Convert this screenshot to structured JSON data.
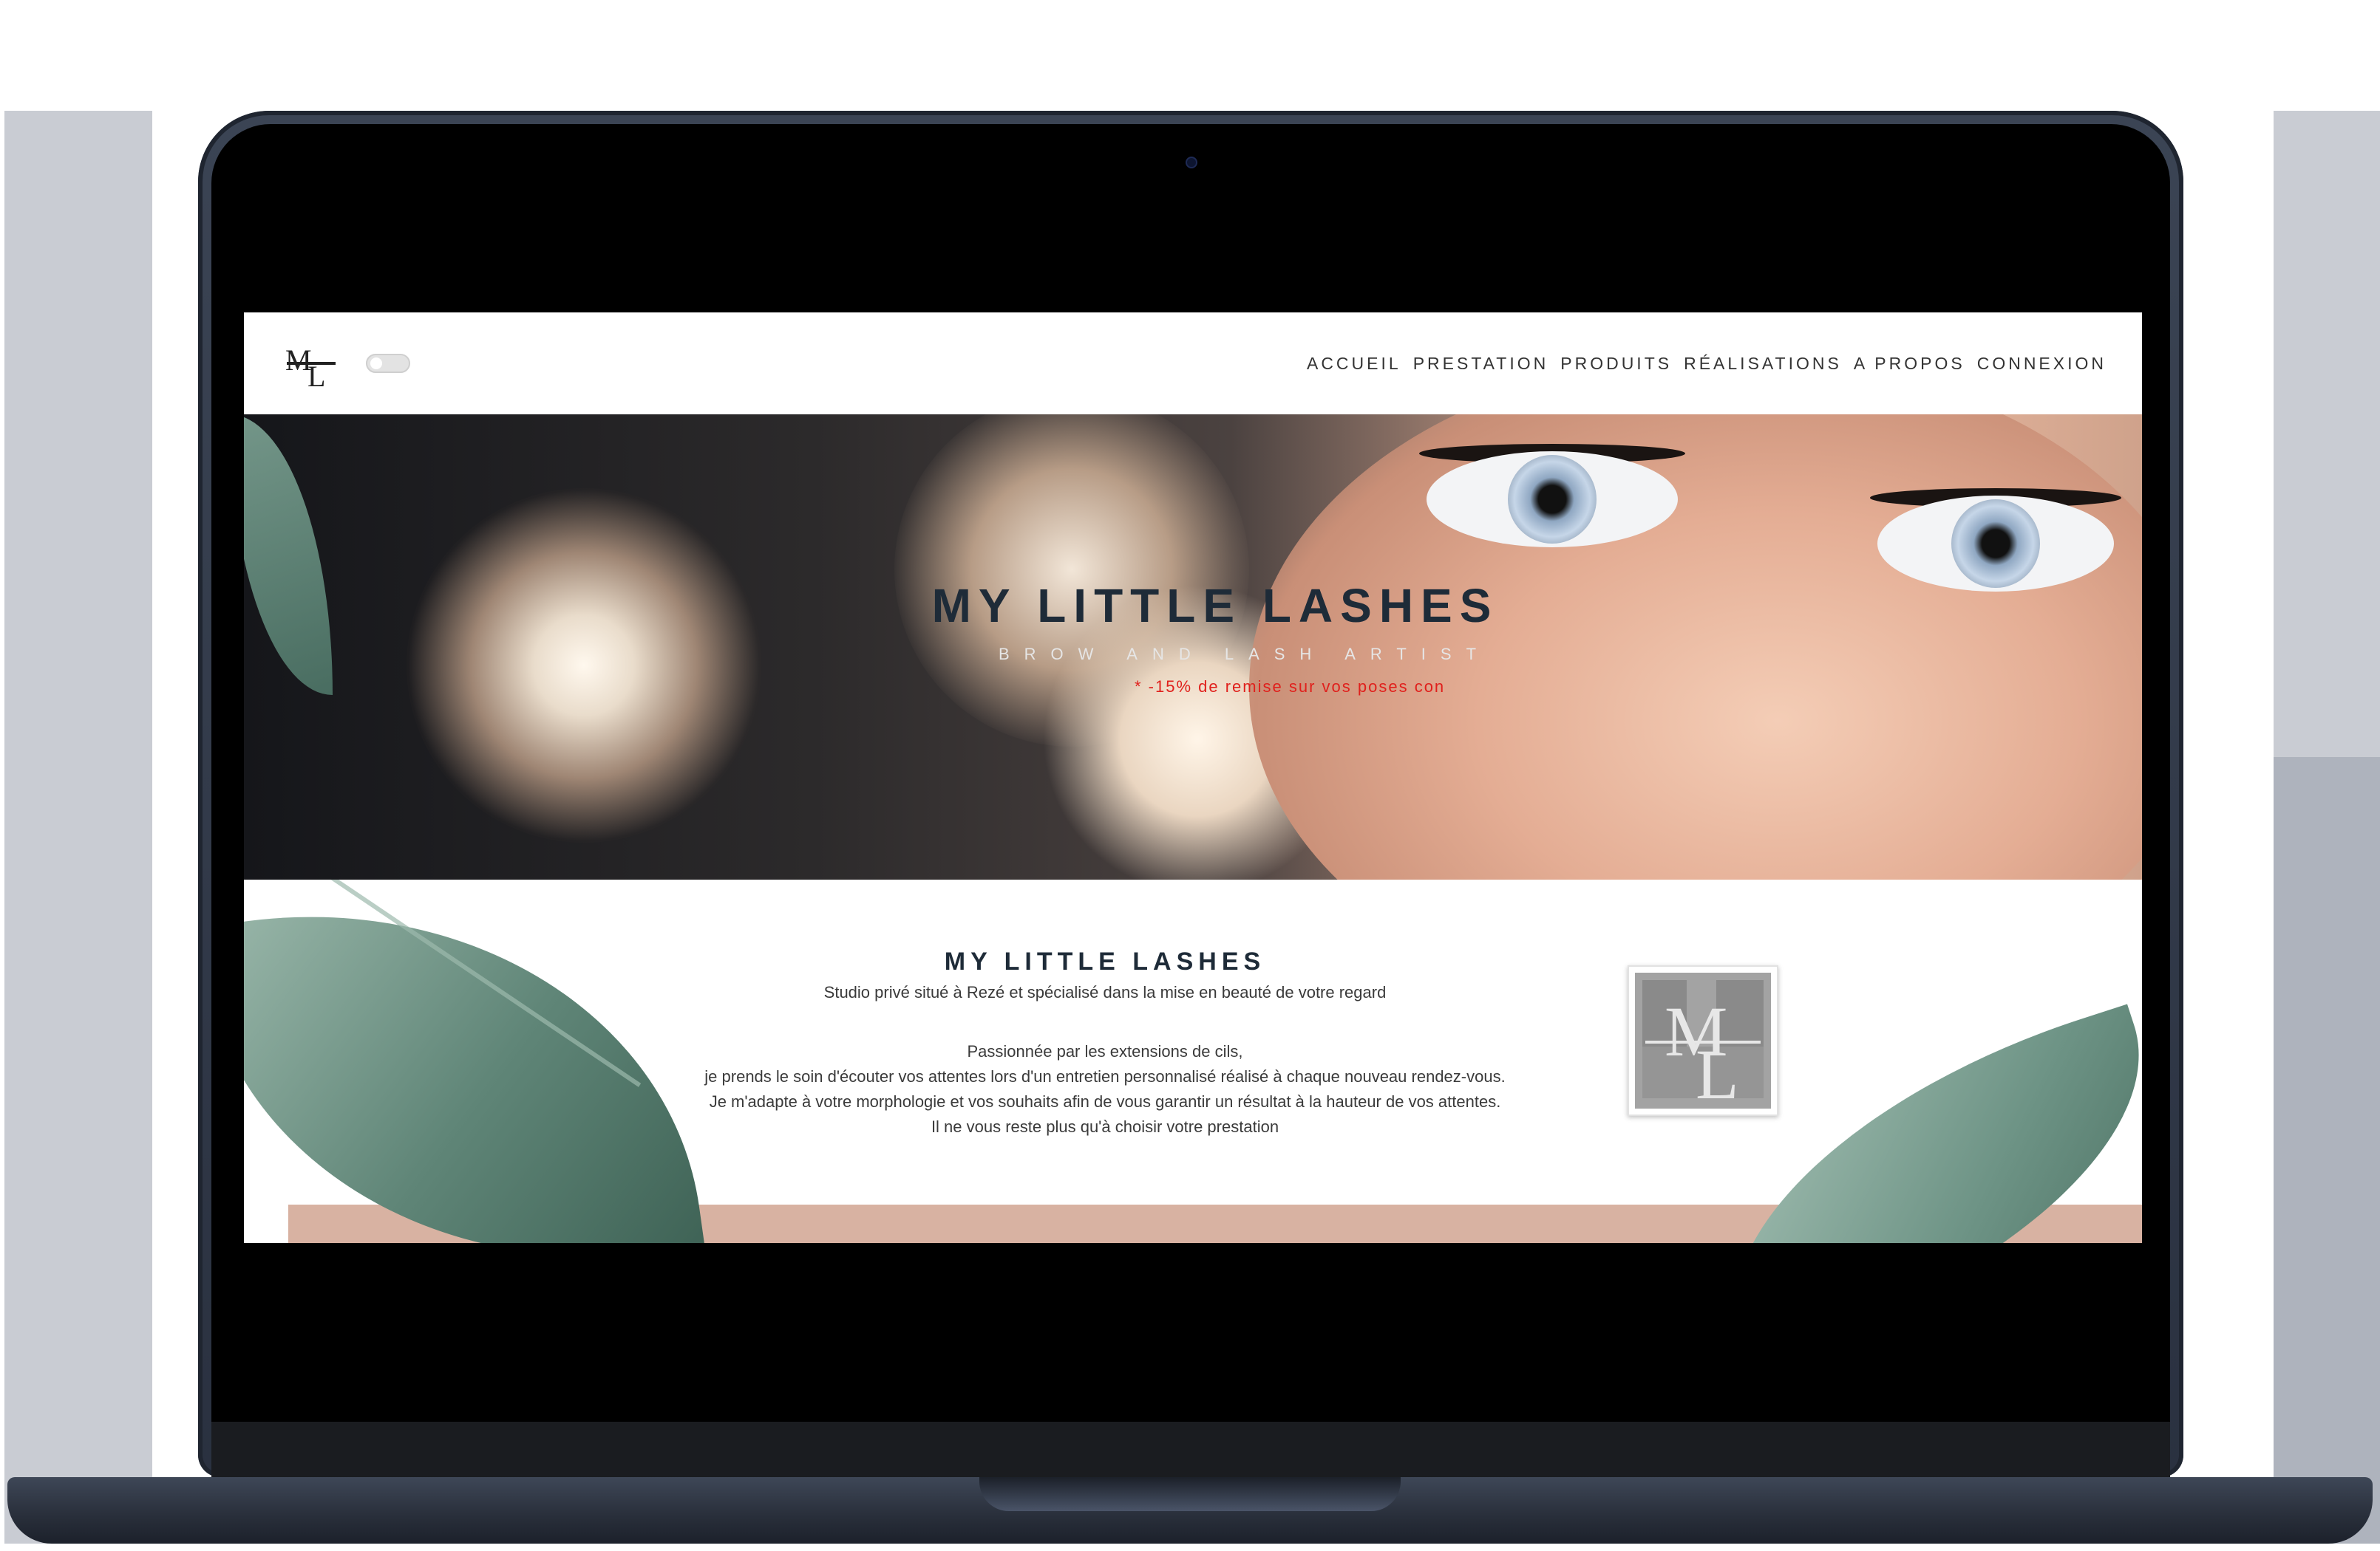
{
  "header": {
    "nav": [
      "ACCUEIL",
      "PRESTATION",
      "PRODUITS",
      "RÉALISATIONS",
      "A PROPOS",
      "CONNEXION"
    ]
  },
  "hero": {
    "title": "MY LITTLE LASHES",
    "subtitle": "BROW AND LASH ARTIST",
    "promo": "* -15% de remise sur vos poses con"
  },
  "intro": {
    "title": "MY LITTLE LASHES",
    "lead": "Studio privé situé à Rezé et spécialisé dans la mise en beauté de votre regard",
    "paragraph": [
      "Passionnée par les extensions de cils,",
      "je prends le soin d'écouter vos attentes lors d'un entretien personnalisé réalisé à chaque nouveau rendez-vous.",
      "Je m'adapte à votre morphologie et vos souhaits afin de vous garantir un résultat à la hauteur de vos attentes.",
      "Il ne vous reste plus qu'à choisir votre prestation"
    ]
  },
  "colors": {
    "title": "#1e2b38",
    "promo": "#e0201c",
    "band": "#d8b2a2",
    "leaf": "#5f8577"
  },
  "icons": [
    "logo-ml-icon",
    "theme-toggle"
  ]
}
